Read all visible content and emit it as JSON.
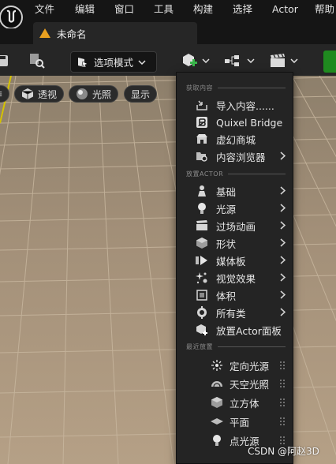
{
  "menubar": {
    "items": [
      "文件",
      "编辑",
      "窗口",
      "工具",
      "构建",
      "选择",
      "Actor",
      "帮助"
    ]
  },
  "tab": {
    "title": "未命名"
  },
  "toolbar": {
    "mode_label": "选项模式"
  },
  "viewport": {
    "perspective_label": "透视",
    "lit_label": "光照",
    "show_label": "显示"
  },
  "dropdown": {
    "sections": {
      "get_content": "获取内容",
      "place_actor": "放置ACTOR",
      "recent": "最近放置"
    },
    "get_content_items": [
      {
        "label": "导入内容......",
        "icon": "import-icon",
        "submenu": false
      },
      {
        "label": "Quixel Bridge",
        "icon": "quixel-bridge-icon",
        "submenu": false
      },
      {
        "label": "虚幻商城",
        "icon": "marketplace-icon",
        "submenu": false
      },
      {
        "label": "内容浏览器",
        "icon": "content-browser-icon",
        "submenu": true
      }
    ],
    "place_items": [
      {
        "label": "基础",
        "icon": "basic-actor-icon",
        "submenu": true
      },
      {
        "label": "光源",
        "icon": "light-bulb-icon",
        "submenu": true
      },
      {
        "label": "过场动画",
        "icon": "cinematics-icon",
        "submenu": true
      },
      {
        "label": "形状",
        "icon": "shape-cube-icon",
        "submenu": true
      },
      {
        "label": "媒体板",
        "icon": "media-icon",
        "submenu": true
      },
      {
        "label": "视觉效果",
        "icon": "visual-effects-icon",
        "submenu": true
      },
      {
        "label": "体积",
        "icon": "volume-icon",
        "submenu": true
      },
      {
        "label": "所有类",
        "icon": "all-classes-icon",
        "submenu": true
      },
      {
        "label": "放置Actor面板",
        "icon": "place-actors-panel-icon",
        "submenu": false
      }
    ],
    "recent_items": [
      {
        "label": "定向光源",
        "icon": "directional-light-icon"
      },
      {
        "label": "天空光照",
        "icon": "sky-light-icon"
      },
      {
        "label": "立方体",
        "icon": "cube-icon"
      },
      {
        "label": "平面",
        "icon": "plane-icon"
      },
      {
        "label": "点光源",
        "icon": "point-light-icon"
      }
    ]
  },
  "watermark": "CSDN @阿赵3D"
}
